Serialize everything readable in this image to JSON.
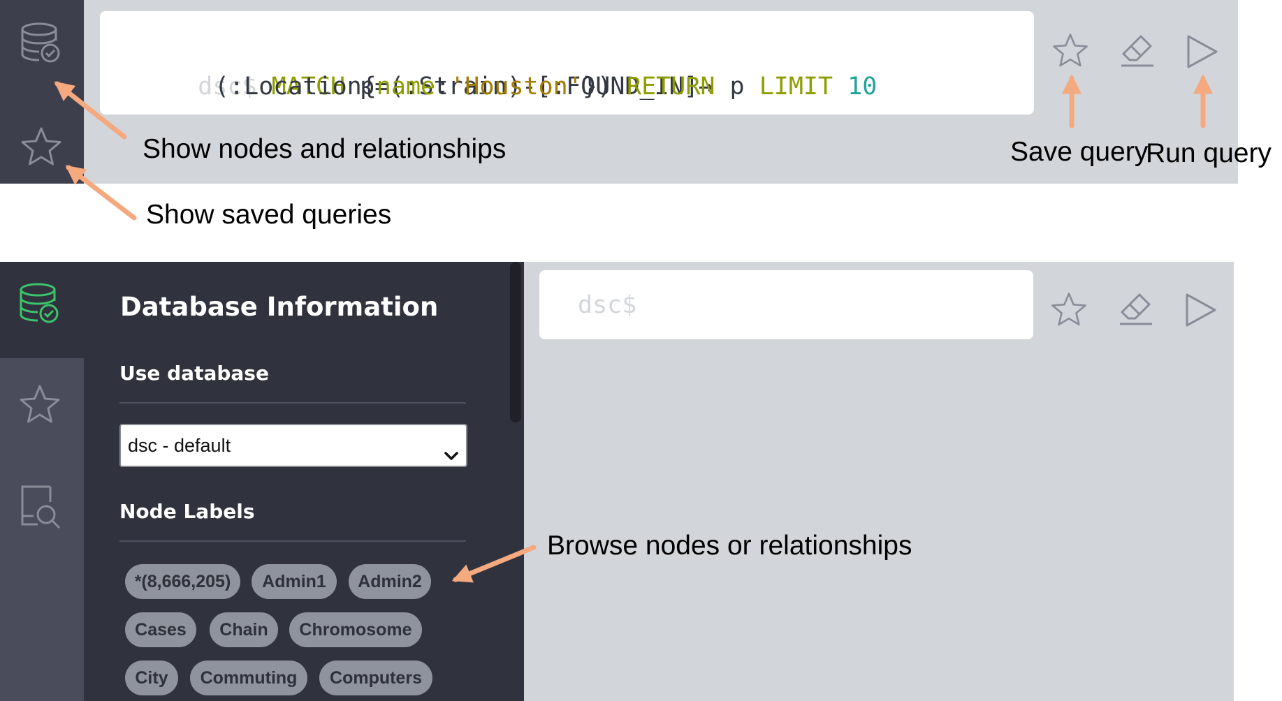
{
  "top": {
    "prompt": "dsc$",
    "query": {
      "line1": [
        {
          "text": "MATCH ",
          "cls": "kw"
        },
        {
          "text": "p=(:Strain)-[:FOUND_IN]→",
          "cls": "plain"
        }
      ],
      "line2": [
        {
          "text": "(:Location{",
          "cls": "plain"
        },
        {
          "text": "name",
          "cls": "prop"
        },
        {
          "text": ":",
          "cls": "plain"
        },
        {
          "text": "'Houston'",
          "cls": "str"
        },
        {
          "text": "}) ",
          "cls": "plain"
        },
        {
          "text": "RETURN",
          "cls": "kw"
        },
        {
          "text": " p ",
          "cls": "plain"
        },
        {
          "text": "LIMIT",
          "cls": "kw"
        },
        {
          "text": " ",
          "cls": "plain"
        },
        {
          "text": "10",
          "cls": "num"
        }
      ]
    },
    "annotations": {
      "nodes_relationships": "Show nodes and relationships",
      "saved_queries": "Show saved queries",
      "save_query": "Save query",
      "run_query": "Run query"
    }
  },
  "bottom": {
    "panel_title": "Database Information",
    "use_database_heading": "Use database",
    "database_selected": "dsc - default",
    "node_labels_heading": "Node Labels",
    "node_labels": [
      "*(8,666,205)",
      "Admin1",
      "Admin2",
      "Cases",
      "Chain",
      "Chromosome",
      "City",
      "Commuting",
      "Computers"
    ],
    "prompt": "dsc$",
    "annotation_browse": "Browse nodes or relationships"
  },
  "colors": {
    "sidebar_dark": "#30323d",
    "sidebar_mid": "#4a4b5b",
    "main_bg": "#d2d5da",
    "chip_bg": "#8f939d",
    "accent_green": "#3cc46b",
    "arrow": "#f5a97f",
    "keyword": "#8e9e00",
    "string": "#a47d00",
    "number": "#1fa39a"
  },
  "icons": {
    "database": "database-check-icon",
    "favorites": "star-icon",
    "search_doc": "document-search-icon",
    "save": "star-icon",
    "clear": "eraser-icon",
    "run": "play-icon",
    "dropdown": "chevron-down-icon"
  }
}
